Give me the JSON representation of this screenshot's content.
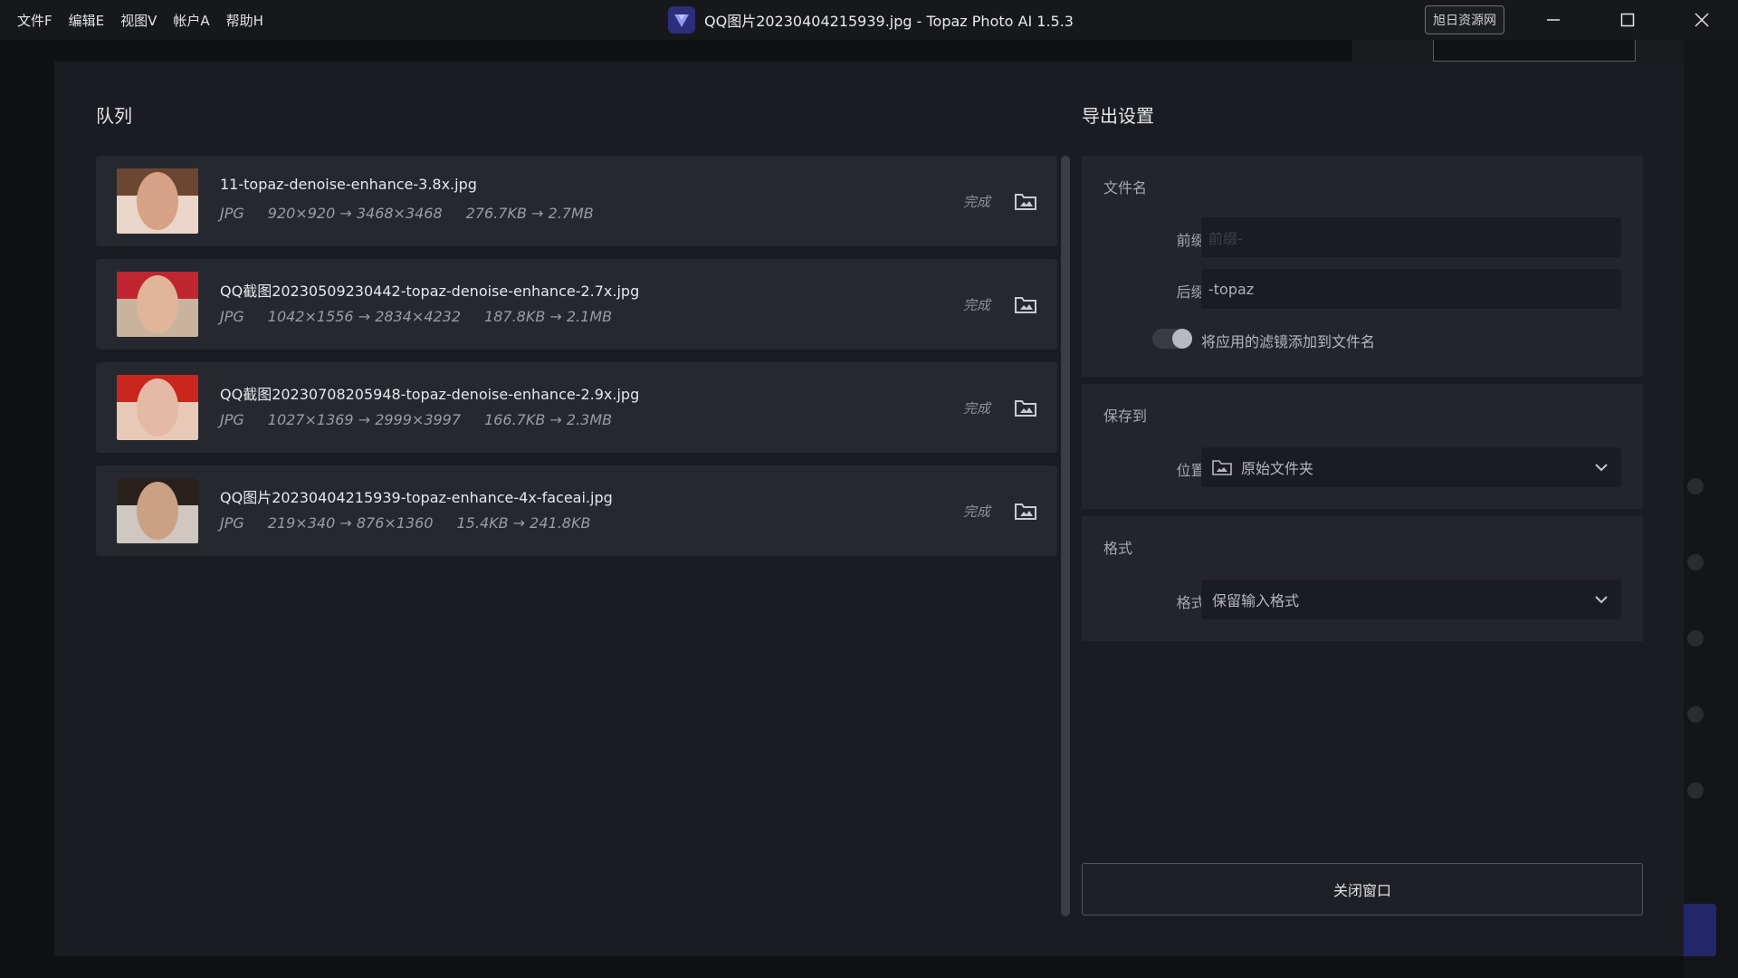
{
  "menu": [
    "文件F",
    "编辑E",
    "视图V",
    "帐户A",
    "帮助H"
  ],
  "window": {
    "title": "QQ图片20230404215939.jpg - Topaz Photo AI 1.5.3",
    "badge": "旭日资源网"
  },
  "queue": {
    "title": "队列",
    "items": [
      {
        "name": "11-topaz-denoise-enhance-3.8x.jpg",
        "format": "JPG",
        "dims": "920×920 → 3468×3468",
        "size": "276.7KB → 2.7MB",
        "status": "完成",
        "thumb_skin": "#d6a184",
        "thumb_bg": "#e9d6c8",
        "thumb_hair": "#6b4732"
      },
      {
        "name": "QQ截图20230509230442-topaz-denoise-enhance-2.7x.jpg",
        "format": "JPG",
        "dims": "1042×1556 → 2834×4232",
        "size": "187.8KB → 2.1MB",
        "status": "完成",
        "thumb_skin": "#e0b59b",
        "thumb_bg": "#c9b39c",
        "thumb_hair": "#c0262f"
      },
      {
        "name": "QQ截图20230708205948-topaz-denoise-enhance-2.9x.jpg",
        "format": "JPG",
        "dims": "1027×1369 → 2999×3997",
        "size": "166.7KB → 2.3MB",
        "status": "完成",
        "thumb_skin": "#e4b9a6",
        "thumb_bg": "#e8c8b7",
        "thumb_hair": "#c9261e"
      },
      {
        "name": "QQ图片20230404215939-topaz-enhance-4x-faceai.jpg",
        "format": "JPG",
        "dims": "219×340 → 876×1360",
        "size": "15.4KB → 241.8KB",
        "status": "完成",
        "thumb_skin": "#caa182",
        "thumb_bg": "#cfc7c0",
        "thumb_hair": "#2a211d"
      }
    ]
  },
  "export": {
    "title": "导出设置",
    "filename": {
      "section": "文件名",
      "prefix_label": "前缀:",
      "prefix_placeholder": "前缀-",
      "suffix_label": "后缀:",
      "suffix_value": "-topaz",
      "toggle_label": "将应用的滤镜添加到文件名"
    },
    "save": {
      "section": "保存到",
      "location_label": "位置:",
      "location_value": "原始文件夹"
    },
    "format": {
      "section": "格式",
      "format_label": "格式:",
      "format_value": "保留输入格式"
    },
    "close_button": "关闭窗口"
  }
}
